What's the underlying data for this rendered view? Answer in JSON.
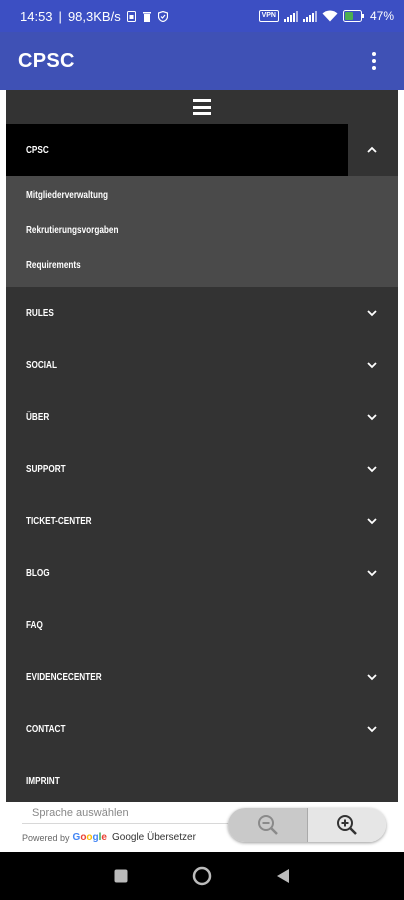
{
  "status_bar": {
    "time": "14:53",
    "net_speed": "98,3KB/s",
    "vpn_label": "VPN",
    "battery": "47",
    "icons": [
      "sim-icon",
      "trash-icon",
      "shield-icon",
      "vpn-icon",
      "signal-icon",
      "signal-icon",
      "wifi-icon",
      "battery-icon"
    ]
  },
  "app_bar": {
    "title": "CPSC",
    "overflow_icon": "more-vert-icon"
  },
  "menu": {
    "hamburger_icon": "hamburger-icon",
    "items": [
      {
        "label": "CPSC",
        "expanded": true,
        "has_chevron": true,
        "children": [
          "Mitgliederverwaltung",
          "Rekrutierungsvorgaben",
          "Requirements"
        ]
      },
      {
        "label": "RULES",
        "has_chevron": true
      },
      {
        "label": "SOCIAL",
        "has_chevron": true
      },
      {
        "label": "ÜBER",
        "has_chevron": true
      },
      {
        "label": "SUPPORT",
        "has_chevron": true
      },
      {
        "label": "TICKET-CENTER",
        "has_chevron": true
      },
      {
        "label": "BLOG",
        "has_chevron": true
      },
      {
        "label": "FAQ",
        "has_chevron": false
      },
      {
        "label": "EVIDENCECENTER",
        "has_chevron": true
      },
      {
        "label": "CONTACT",
        "has_chevron": true
      },
      {
        "label": "IMPRINT",
        "has_chevron": false
      }
    ]
  },
  "translate": {
    "placeholder": "Sprache auswählen",
    "powered_by": "Powered by",
    "google_letters": [
      "G",
      "o",
      "o",
      "g",
      "l",
      "e"
    ],
    "translator": "Google Übersetzer"
  },
  "zoom": {
    "out_icon": "zoom-out-icon",
    "in_icon": "zoom-in-icon"
  },
  "nav_bar": {
    "icons": [
      "recents-icon",
      "home-icon",
      "back-icon"
    ]
  },
  "colors": {
    "app_bar": "#3f51b5",
    "menu_bg": "#333333",
    "active_bg": "#000000",
    "submenu_bg": "#4a4a4a"
  }
}
